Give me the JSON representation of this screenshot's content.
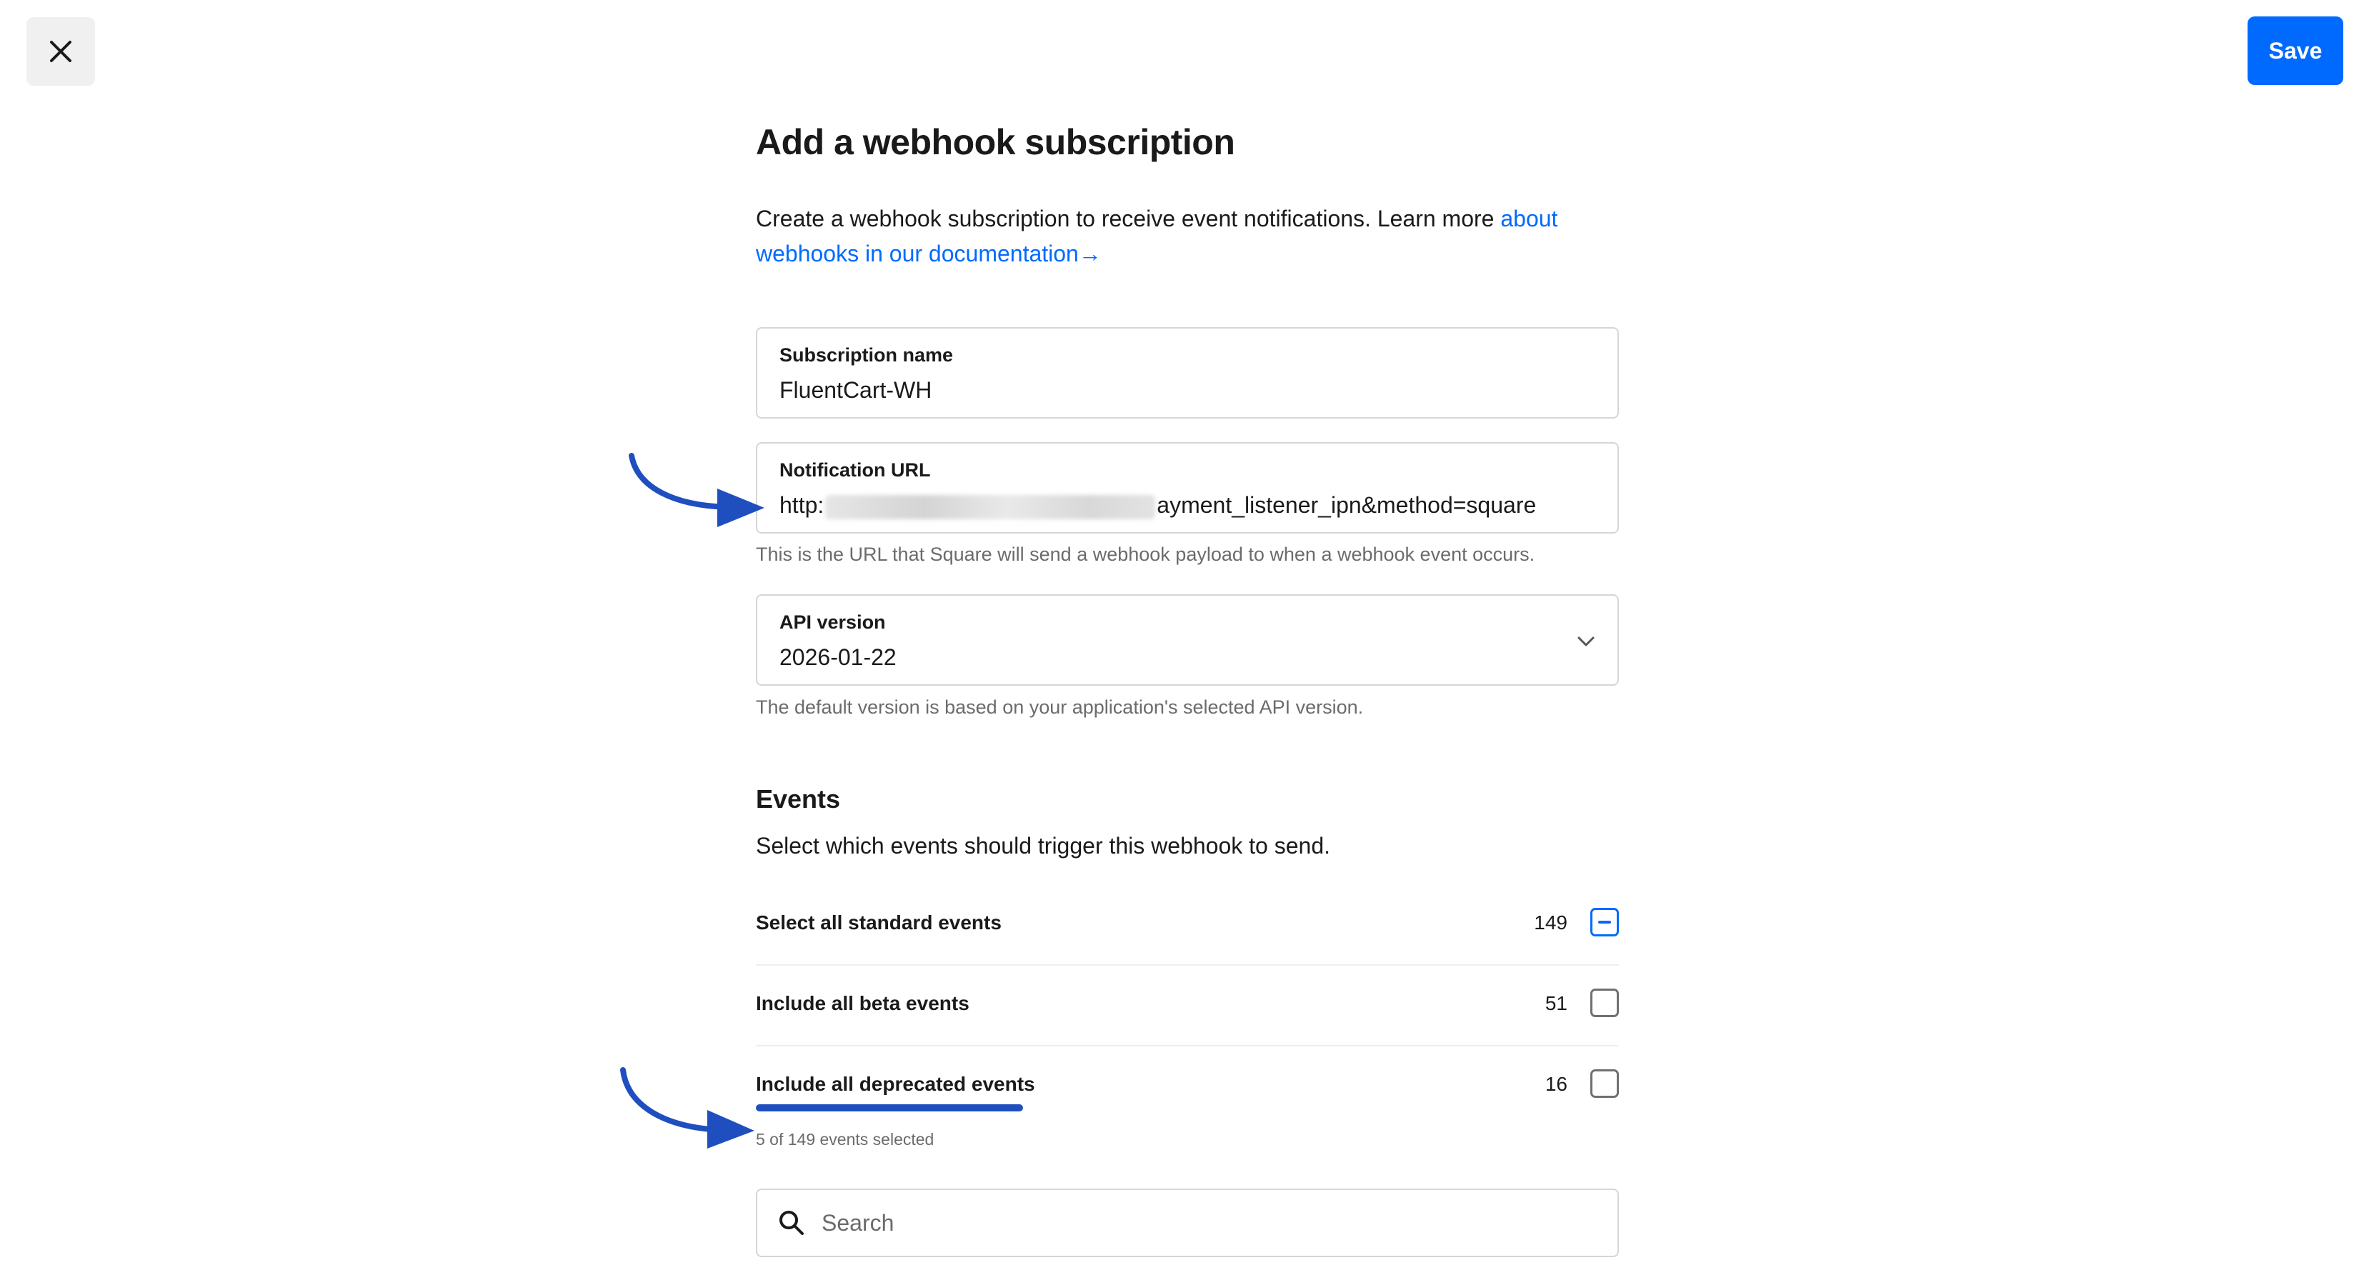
{
  "header": {
    "close_icon": "close-icon",
    "save_label": "Save"
  },
  "form": {
    "title": "Add a webhook subscription",
    "intro_text": "Create a webhook subscription to receive event notifications. Learn more ",
    "intro_link": "about webhooks in our documentation",
    "intro_link_arrow": "→",
    "subscription_name": {
      "label": "Subscription name",
      "value": "FluentCart-WH"
    },
    "notification_url": {
      "label": "Notification URL",
      "value_prefix": "http:",
      "value_suffix": "ayment_listener_ipn&method=square",
      "helper": "This is the URL that Square will send a webhook payload to when a webhook event occurs."
    },
    "api_version": {
      "label": "API version",
      "value": "2026-01-22",
      "helper": "The default version is based on your application's selected API version."
    }
  },
  "events": {
    "title": "Events",
    "subtitle": "Select which events should trigger this webhook to send.",
    "rows": [
      {
        "label": "Select all standard events",
        "count": "149",
        "state": "indeterminate"
      },
      {
        "label": "Include all beta events",
        "count": "51",
        "state": "unchecked"
      },
      {
        "label": "Include all deprecated events",
        "count": "16",
        "state": "unchecked"
      }
    ],
    "selected_summary": "5 of 149 events selected",
    "search": {
      "placeholder": "Search"
    }
  },
  "colors": {
    "accent": "#006aff",
    "annotation": "#1f4fbf"
  }
}
